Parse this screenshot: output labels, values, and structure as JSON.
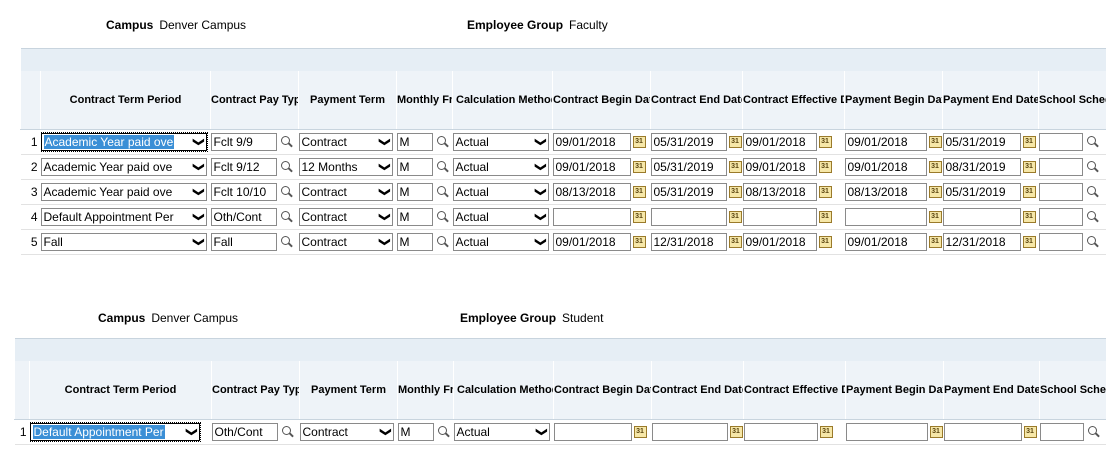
{
  "sections": [
    {
      "campus_label": "Campus",
      "campus_value": "Denver Campus",
      "group_label": "Employee Group",
      "group_value": "Faculty",
      "headers": [
        "Contract Term Period",
        "Contract Pay Type",
        "Payment Term",
        "Monthly Freq",
        "Calculation Method",
        "Contract Begin Date",
        "Contract End Date",
        "Contract Effective Date",
        "Payment Begin Date",
        "Payment End Date",
        "School Schedule"
      ],
      "rows": [
        {
          "num": "1",
          "term": "Academic Year paid ove",
          "pay": "Fclt 9/9",
          "pterm": "Contract",
          "freq": "M",
          "calc": "Actual",
          "begin": "09/01/2018",
          "end": "05/31/2019",
          "eff": "09/01/2018",
          "pbegin": "09/01/2018",
          "pend": "05/31/2019",
          "sched": ""
        },
        {
          "num": "2",
          "term": "Academic Year paid ove",
          "pay": "Fclt 9/12",
          "pterm": "12 Months",
          "freq": "M",
          "calc": "Actual",
          "begin": "09/01/2018",
          "end": "05/31/2019",
          "eff": "09/01/2018",
          "pbegin": "09/01/2018",
          "pend": "08/31/2019",
          "sched": ""
        },
        {
          "num": "3",
          "term": "Academic Year paid ove",
          "pay": "Fclt 10/10",
          "pterm": "Contract",
          "freq": "M",
          "calc": "Actual",
          "begin": "08/13/2018",
          "end": "05/31/2019",
          "eff": "08/13/2018",
          "pbegin": "08/13/2018",
          "pend": "05/31/2019",
          "sched": ""
        },
        {
          "num": "4",
          "term": "Default Appointment Per",
          "pay": "Oth/Cont",
          "pterm": "Contract",
          "freq": "M",
          "calc": "Actual",
          "begin": "",
          "end": "",
          "eff": "",
          "pbegin": "",
          "pend": "",
          "sched": ""
        },
        {
          "num": "5",
          "term": "Fall",
          "pay": "Fall",
          "pterm": "Contract",
          "freq": "M",
          "calc": "Actual",
          "begin": "09/01/2018",
          "end": "12/31/2018",
          "eff": "09/01/2018",
          "pbegin": "09/01/2018",
          "pend": "12/31/2018",
          "sched": ""
        }
      ]
    },
    {
      "campus_label": "Campus",
      "campus_value": "Denver Campus",
      "group_label": "Employee Group",
      "group_value": "Student",
      "headers": [
        "Contract Term Period",
        "Contract Pay Type",
        "Payment Term",
        "Monthly Freq",
        "Calculation Method",
        "Contract Begin Date",
        "Contract End Date",
        "Contract Effective Date",
        "Payment Begin Date",
        "Payment End Date",
        "School Schedule"
      ],
      "rows": [
        {
          "num": "1",
          "term": "Default Appointment Per",
          "pay": "Oth/Cont",
          "pterm": "Contract",
          "freq": "M",
          "calc": "Actual",
          "begin": "",
          "end": "",
          "eff": "",
          "pbegin": "",
          "pend": "",
          "sched": ""
        }
      ]
    }
  ],
  "icons": {
    "lookup": "search-icon",
    "calendar": "calendar-icon",
    "dropdown": "chevron-down-icon"
  },
  "calendar_glyph": "31",
  "dropdown_glyph": "❯",
  "colors": {
    "header_band": "#e6eef5",
    "selection": "#3b8fd6"
  }
}
